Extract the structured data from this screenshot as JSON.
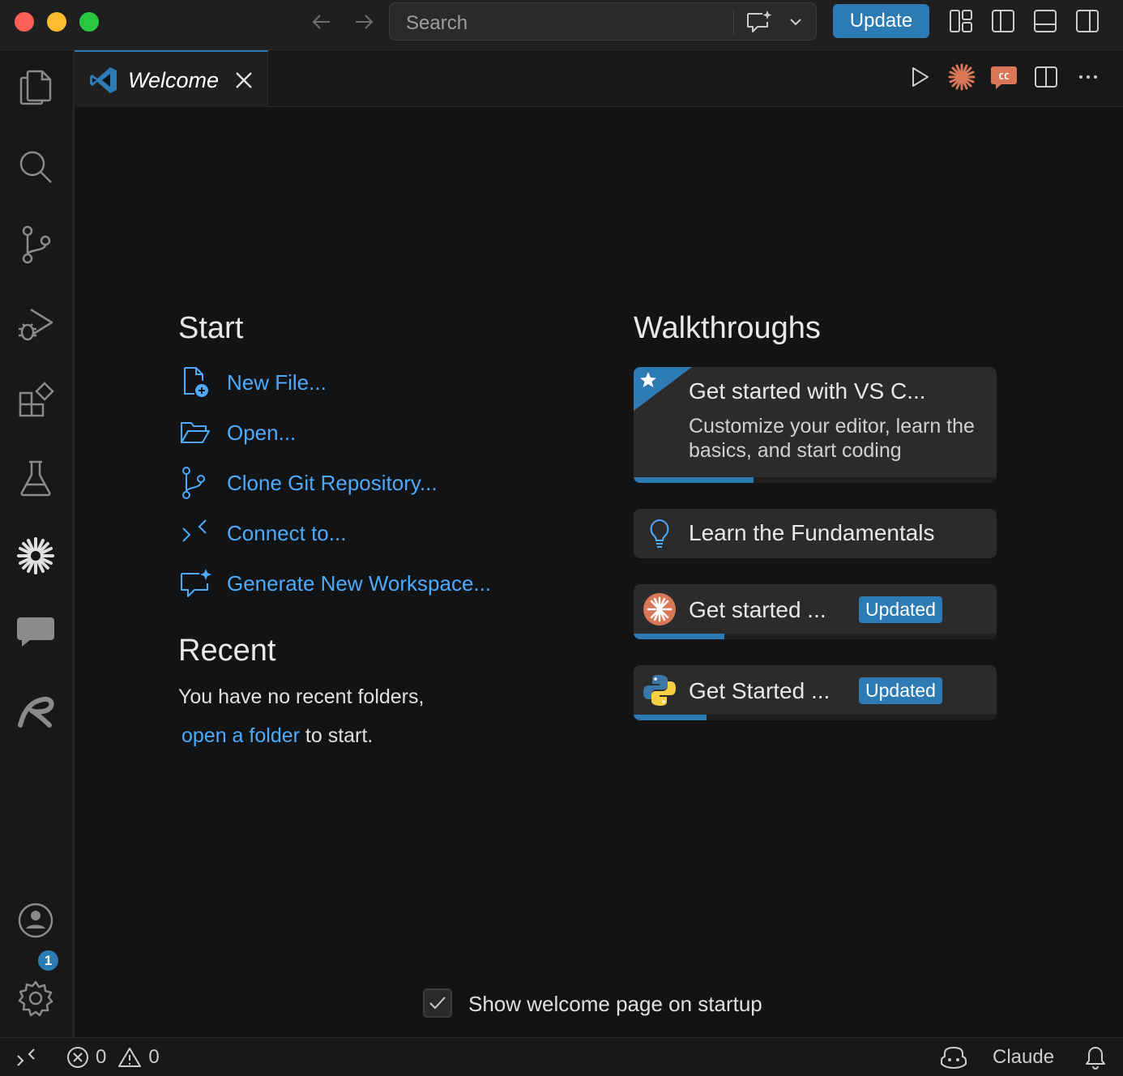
{
  "titlebar": {
    "search_placeholder": "Search",
    "update_label": "Update"
  },
  "tab": {
    "title": "Welcome"
  },
  "start": {
    "heading": "Start",
    "items": [
      {
        "label": "New File...",
        "icon": "new-file-icon"
      },
      {
        "label": "Open...",
        "icon": "folder-open-icon"
      },
      {
        "label": "Clone Git Repository...",
        "icon": "source-control-icon"
      },
      {
        "label": "Connect to...",
        "icon": "remote-icon"
      },
      {
        "label": "Generate New Workspace...",
        "icon": "chat-sparkle-icon"
      }
    ]
  },
  "recent": {
    "heading": "Recent",
    "line1": "You have no recent folders,",
    "link": "open a folder",
    "line2_suffix": "to start."
  },
  "walkthroughs": {
    "heading": "Walkthroughs",
    "items": [
      {
        "title": "Get started with VS C...",
        "description": "Customize your editor, learn the basics, and start coding",
        "progress": 0.33,
        "icon": "star-icon"
      },
      {
        "title": "Learn the Fundamentals",
        "icon": "lightbulb-icon"
      },
      {
        "title": "Get started ...",
        "badge": "Updated",
        "progress": 0.25,
        "icon": "claude-icon"
      },
      {
        "title": "Get Started ...",
        "badge": "Updated",
        "progress": 0.2,
        "icon": "python-icon"
      }
    ]
  },
  "startup": {
    "label": "Show welcome page on startup",
    "checked": true
  },
  "statusbar": {
    "errors": "0",
    "warnings": "0",
    "claude_label": "Claude"
  },
  "activity": {
    "settings_badge": "1"
  },
  "colors": {
    "accent": "#2c7bb4",
    "link": "#4daafc",
    "claude": "#d97757"
  }
}
